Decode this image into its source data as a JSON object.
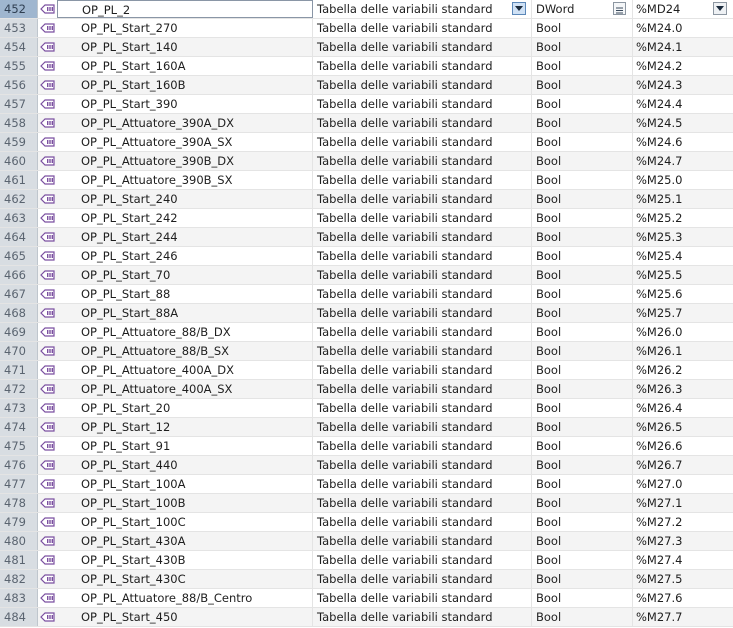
{
  "rows": [
    {
      "num": "452",
      "name": "OP_PL_2",
      "table": "Tabella delle variabili standard",
      "type": "DWord",
      "addr": "%MD24"
    },
    {
      "num": "453",
      "name": "OP_PL_Start_270",
      "table": "Tabella delle variabili standard",
      "type": "Bool",
      "addr": "%M24.0"
    },
    {
      "num": "454",
      "name": "OP_PL_Start_140",
      "table": "Tabella delle variabili standard",
      "type": "Bool",
      "addr": "%M24.1"
    },
    {
      "num": "455",
      "name": "OP_PL_Start_160A",
      "table": "Tabella delle variabili standard",
      "type": "Bool",
      "addr": "%M24.2"
    },
    {
      "num": "456",
      "name": "OP_PL_Start_160B",
      "table": "Tabella delle variabili standard",
      "type": "Bool",
      "addr": "%M24.3"
    },
    {
      "num": "457",
      "name": "OP_PL_Start_390",
      "table": "Tabella delle variabili standard",
      "type": "Bool",
      "addr": "%M24.4"
    },
    {
      "num": "458",
      "name": "OP_PL_Attuatore_390A_DX",
      "table": "Tabella delle variabili standard",
      "type": "Bool",
      "addr": "%M24.5"
    },
    {
      "num": "459",
      "name": "OP_PL_Attuatore_390A_SX",
      "table": "Tabella delle variabili standard",
      "type": "Bool",
      "addr": "%M24.6"
    },
    {
      "num": "460",
      "name": "OP_PL_Attuatore_390B_DX",
      "table": "Tabella delle variabili standard",
      "type": "Bool",
      "addr": "%M24.7"
    },
    {
      "num": "461",
      "name": "OP_PL_Attuatore_390B_SX",
      "table": "Tabella delle variabili standard",
      "type": "Bool",
      "addr": "%M25.0"
    },
    {
      "num": "462",
      "name": "OP_PL_Start_240",
      "table": "Tabella delle variabili standard",
      "type": "Bool",
      "addr": "%M25.1"
    },
    {
      "num": "463",
      "name": "OP_PL_Start_242",
      "table": "Tabella delle variabili standard",
      "type": "Bool",
      "addr": "%M25.2"
    },
    {
      "num": "464",
      "name": "OP_PL_Start_244",
      "table": "Tabella delle variabili standard",
      "type": "Bool",
      "addr": "%M25.3"
    },
    {
      "num": "465",
      "name": "OP_PL_Start_246",
      "table": "Tabella delle variabili standard",
      "type": "Bool",
      "addr": "%M25.4"
    },
    {
      "num": "466",
      "name": "OP_PL_Start_70",
      "table": "Tabella delle variabili standard",
      "type": "Bool",
      "addr": "%M25.5"
    },
    {
      "num": "467",
      "name": "OP_PL_Start_88",
      "table": "Tabella delle variabili standard",
      "type": "Bool",
      "addr": "%M25.6"
    },
    {
      "num": "468",
      "name": "OP_PL_Start_88A",
      "table": "Tabella delle variabili standard",
      "type": "Bool",
      "addr": "%M25.7"
    },
    {
      "num": "469",
      "name": "OP_PL_Attuatore_88/B_DX",
      "table": "Tabella delle variabili standard",
      "type": "Bool",
      "addr": "%M26.0"
    },
    {
      "num": "470",
      "name": "OP_PL_Attuatore_88/B_SX",
      "table": "Tabella delle variabili standard",
      "type": "Bool",
      "addr": "%M26.1"
    },
    {
      "num": "471",
      "name": "OP_PL_Attuatore_400A_DX",
      "table": "Tabella delle variabili standard",
      "type": "Bool",
      "addr": "%M26.2"
    },
    {
      "num": "472",
      "name": "OP_PL_Attuatore_400A_SX",
      "table": "Tabella delle variabili standard",
      "type": "Bool",
      "addr": "%M26.3"
    },
    {
      "num": "473",
      "name": "OP_PL_Start_20",
      "table": "Tabella delle variabili standard",
      "type": "Bool",
      "addr": "%M26.4"
    },
    {
      "num": "474",
      "name": "OP_PL_Start_12",
      "table": "Tabella delle variabili standard",
      "type": "Bool",
      "addr": "%M26.5"
    },
    {
      "num": "475",
      "name": "OP_PL_Start_91",
      "table": "Tabella delle variabili standard",
      "type": "Bool",
      "addr": "%M26.6"
    },
    {
      "num": "476",
      "name": "OP_PL_Start_440",
      "table": "Tabella delle variabili standard",
      "type": "Bool",
      "addr": "%M26.7"
    },
    {
      "num": "477",
      "name": "OP_PL_Start_100A",
      "table": "Tabella delle variabili standard",
      "type": "Bool",
      "addr": "%M27.0"
    },
    {
      "num": "478",
      "name": "OP_PL_Start_100B",
      "table": "Tabella delle variabili standard",
      "type": "Bool",
      "addr": "%M27.1"
    },
    {
      "num": "479",
      "name": "OP_PL_Start_100C",
      "table": "Tabella delle variabili standard",
      "type": "Bool",
      "addr": "%M27.2"
    },
    {
      "num": "480",
      "name": "OP_PL_Start_430A",
      "table": "Tabella delle variabili standard",
      "type": "Bool",
      "addr": "%M27.3"
    },
    {
      "num": "481",
      "name": "OP_PL_Start_430B",
      "table": "Tabella delle variabili standard",
      "type": "Bool",
      "addr": "%M27.4"
    },
    {
      "num": "482",
      "name": "OP_PL_Start_430C",
      "table": "Tabella delle variabili standard",
      "type": "Bool",
      "addr": "%M27.5"
    },
    {
      "num": "483",
      "name": "OP_PL_Attuatore_88/B_Centro",
      "table": "Tabella delle variabili standard",
      "type": "Bool",
      "addr": "%M27.6"
    },
    {
      "num": "484",
      "name": "OP_PL_Start_450",
      "table": "Tabella delle variabili standard",
      "type": "Bool",
      "addr": "%M27.7"
    }
  ],
  "icons": {
    "tag": "plc-tag-icon",
    "table_dropdown": "chevron-down-icon",
    "type_list": "list-icon",
    "addr_dropdown": "chevron-down-icon"
  },
  "colors": {
    "selected_row_number": "#9fb6cf",
    "row_number_bg": "#d8dde2",
    "tag_icon": "#7a4fa0"
  }
}
